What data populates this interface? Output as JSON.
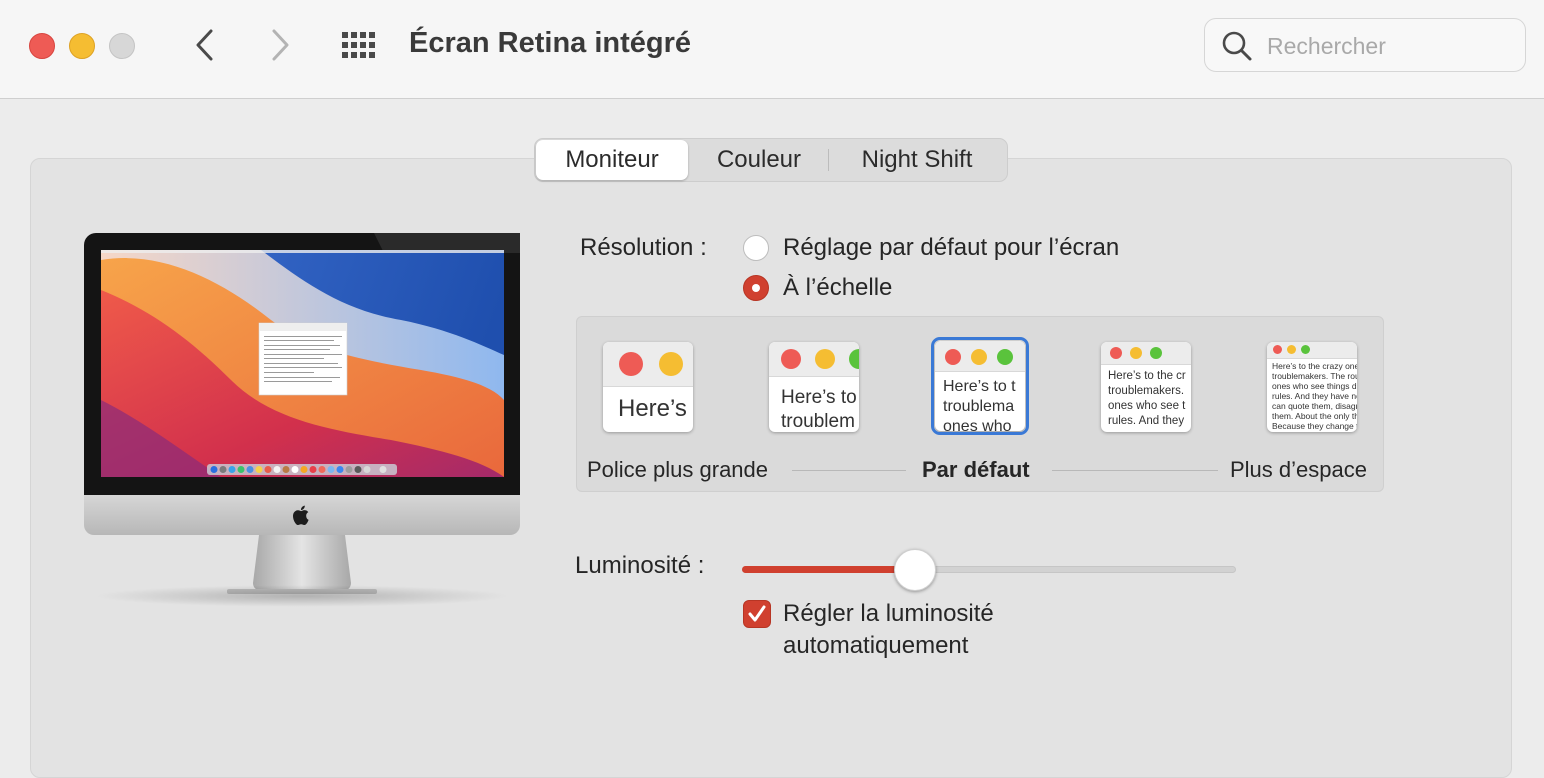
{
  "window": {
    "title": "Écran Retina intégré",
    "search_placeholder": "Rechercher"
  },
  "icons": {
    "close": "close-traffic-light",
    "minimize": "minimize-traffic-light",
    "zoom": "zoom-traffic-light",
    "back": "chevron-left-icon",
    "forward": "chevron-right-icon",
    "grid": "grid-icon",
    "search": "magnifier-icon",
    "apple": "apple-logo-icon"
  },
  "tabs": [
    {
      "label": "Moniteur",
      "active": true
    },
    {
      "label": "Couleur",
      "active": false
    },
    {
      "label": "Night Shift",
      "active": false
    }
  ],
  "resolution": {
    "label": "Résolution :",
    "options": [
      {
        "label": "Réglage par défaut pour l’écran",
        "selected": false
      },
      {
        "label": "À l’échelle",
        "selected": true
      }
    ]
  },
  "scaling": {
    "thumbnails": [
      {
        "text": "Here’s",
        "selected": false
      },
      {
        "text": "Here’s to\ntroublem",
        "selected": false
      },
      {
        "text": "Here’s to t\ntroublema\nones who",
        "selected": true
      },
      {
        "text": "Here’s to the cr\ntroublemakers.\nones who see t\nrules. And they",
        "selected": false
      },
      {
        "text": "Here’s to the crazy one\ntroublemakers. The rou\nones who see things dif\nrules. And they have no\ncan quote them, disagre\nthem. About the only th\nBecause they change th",
        "selected": false
      }
    ],
    "left_label": "Police plus grande",
    "center_label": "Par défaut",
    "right_label": "Plus d’espace"
  },
  "brightness": {
    "label": "Luminosité :",
    "value": 0.35,
    "auto_label_line1": "Régler la luminosité",
    "auto_label_line2": "automatiquement",
    "auto_checked": true
  },
  "colors": {
    "accent": "#d0402f",
    "selection_blue": "#3a79d6",
    "traffic_red": "#ee5b55",
    "traffic_yellow": "#f5bd32",
    "traffic_green": "#5ac33c",
    "traffic_inactive": "#d7d7d7"
  }
}
